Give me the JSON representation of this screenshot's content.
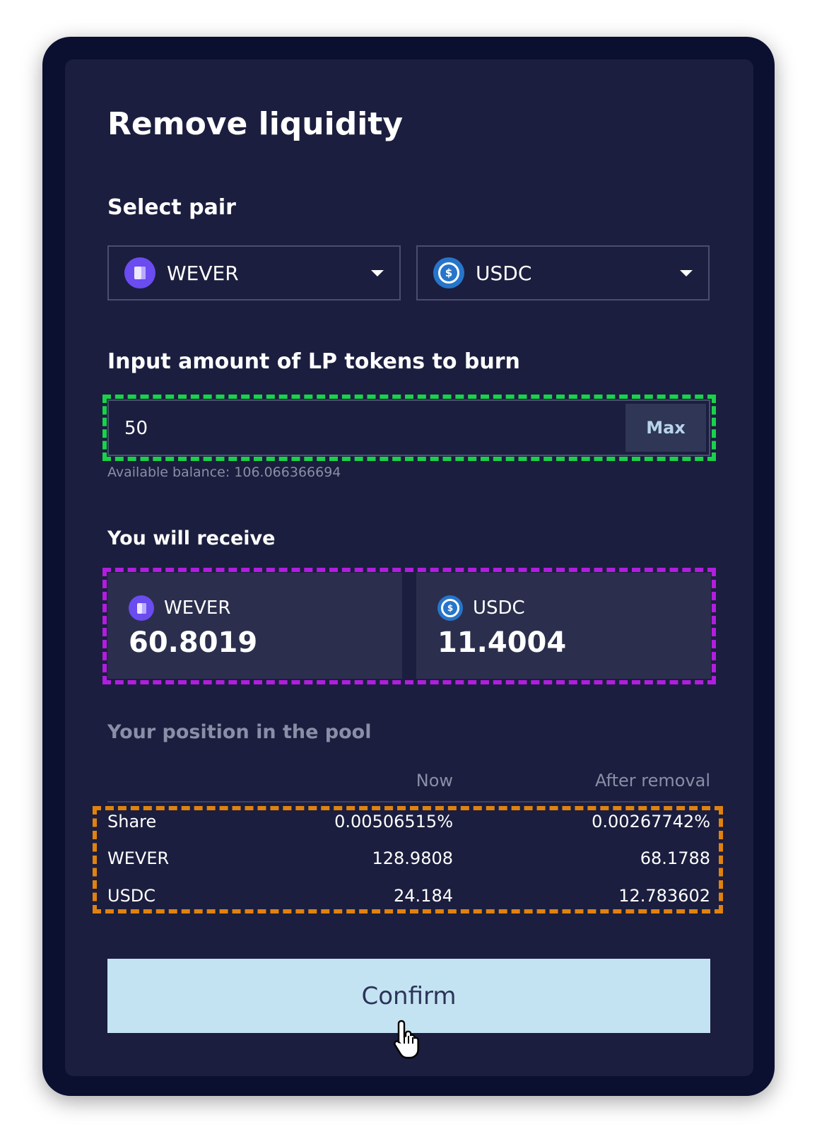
{
  "title": "Remove liquidity",
  "select_pair": {
    "label": "Select pair",
    "token_a": {
      "symbol": "WEVER",
      "icon": "wever-token-icon"
    },
    "token_b": {
      "symbol": "USDC",
      "icon": "usdc-token-icon"
    }
  },
  "lp_input": {
    "label": "Input amount of LP tokens to burn",
    "value": "50",
    "max_label": "Max",
    "available_balance": "Available balance: 106.066366694"
  },
  "receive": {
    "label": "You will receive",
    "items": [
      {
        "symbol": "WEVER",
        "amount": "60.8019"
      },
      {
        "symbol": "USDC",
        "amount": "11.4004"
      }
    ]
  },
  "position": {
    "label": "Your position in the pool",
    "headers": [
      "Now",
      "After removal"
    ],
    "rows": [
      {
        "label": "Share",
        "now": "0.00506515%",
        "after": "0.00267742%"
      },
      {
        "label": "WEVER",
        "now": "128.9808",
        "after": "68.1788"
      },
      {
        "label": "USDC",
        "now": "24.184",
        "after": "12.783602"
      }
    ]
  },
  "confirm_label": "Confirm",
  "colors": {
    "highlight_input": "#19d24a",
    "highlight_receive": "#b21de0",
    "highlight_position": "#e0820f",
    "confirm_bg": "#c4e3f2"
  }
}
